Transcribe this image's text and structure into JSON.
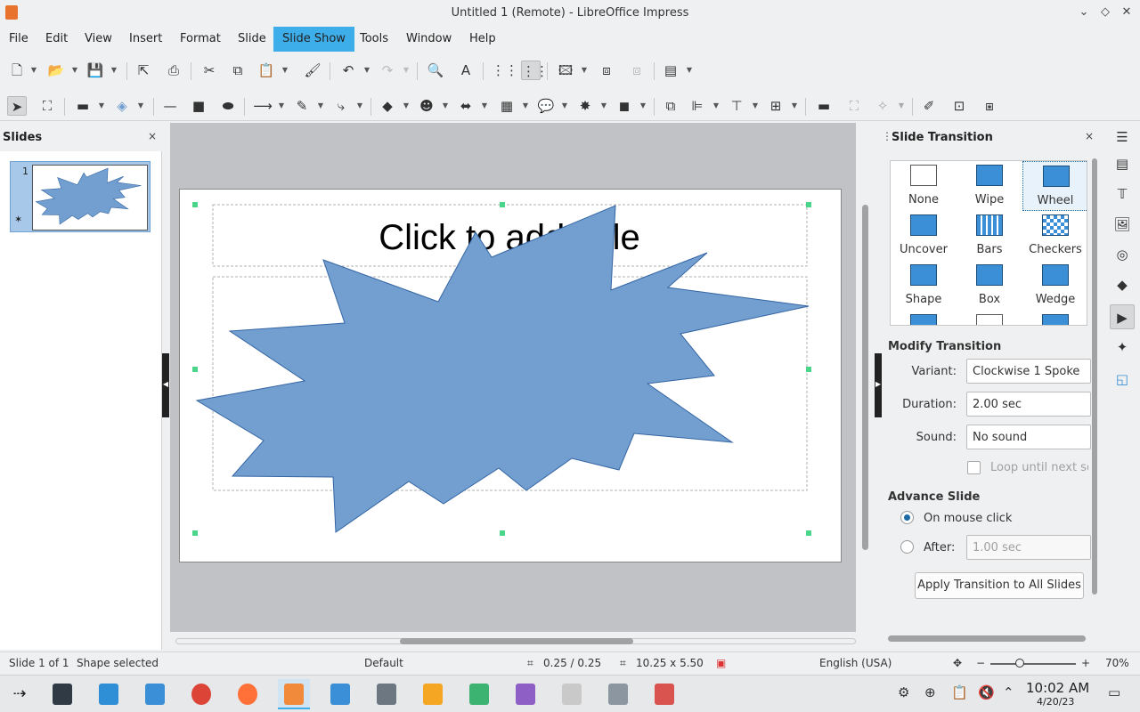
{
  "window": {
    "title": "Untitled 1 (Remote) - LibreOffice Impress"
  },
  "menu": [
    "File",
    "Edit",
    "View",
    "Insert",
    "Format",
    "Slide",
    "Slide Show",
    "Tools",
    "Window",
    "Help"
  ],
  "active_menu": "Slide Show",
  "slides_panel": {
    "title": "Slides",
    "close": "×",
    "slide_number": "1"
  },
  "slide": {
    "title_placeholder": "Click to add Title",
    "shape": "explosion-star",
    "shape_color": "#729fcf",
    "shape_border": "#3465a4",
    "handle_color": "#4ad68a"
  },
  "sidebar": {
    "title": "Slide Transition",
    "close": "×",
    "transitions": [
      {
        "label": "None",
        "icon": "none-transition-icon"
      },
      {
        "label": "Wipe",
        "icon": "wipe-transition-icon"
      },
      {
        "label": "Wheel",
        "icon": "wheel-transition-icon"
      },
      {
        "label": "Uncover",
        "icon": "uncover-transition-icon"
      },
      {
        "label": "Bars",
        "icon": "bars-transition-icon"
      },
      {
        "label": "Checkers",
        "icon": "checkers-transition-icon"
      },
      {
        "label": "Shape",
        "icon": "shape-transition-icon"
      },
      {
        "label": "Box",
        "icon": "box-transition-icon"
      },
      {
        "label": "Wedge",
        "icon": "wedge-transition-icon"
      }
    ],
    "selected_transition": "Wheel",
    "modify_title": "Modify Transition",
    "variant_label": "Variant:",
    "variant_value": "Clockwise 1 Spoke",
    "duration_label": "Duration:",
    "duration_value": "2.00 sec",
    "sound_label": "Sound:",
    "sound_value": "No sound",
    "loop_label": "Loop until next so",
    "advance_title": "Advance Slide",
    "on_click_label": "On mouse click",
    "after_label": "After:",
    "after_value": "1.00 sec",
    "apply_button": "Apply Transition to All Slides"
  },
  "status": {
    "slide": "Slide 1 of 1",
    "selection": "Shape selected",
    "layout": "Default",
    "position": "0.25 / 0.25",
    "size": "10.25 x 5.50",
    "language": "English (USA)",
    "zoom_minus": "−",
    "zoom_plus": "+",
    "zoom": "70%"
  },
  "taskbar": {
    "time": "10:02 AM",
    "date": "4/20/23"
  },
  "colors": {
    "accent": "#3daee9",
    "selection": "#1d6aa6"
  }
}
